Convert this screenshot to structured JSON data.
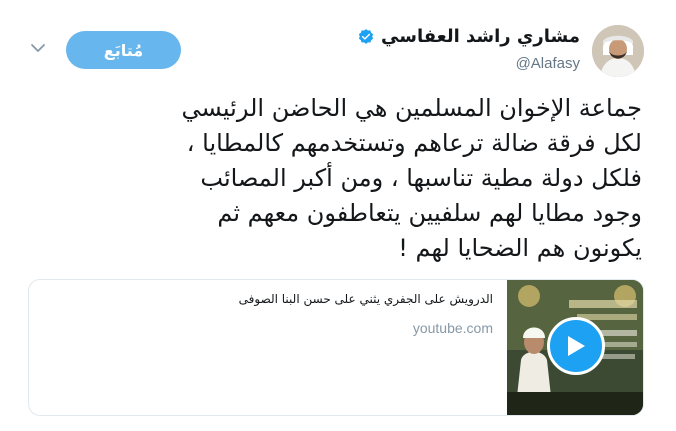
{
  "tweet": {
    "author": {
      "display_name": "مشاري راشد العفاسي",
      "handle": "@Alafasy",
      "verified": true
    },
    "follow_label": "مُتابَع",
    "text": "جماعة الإخوان المسلمين هي الحاضن الرئيسي\nلكل فرقة ضالة ترعاهم وتستخدمهم كالمطايا ،\nفلكل دولة مطية تناسبها ، ومن أكبر المصائب\nوجود مطايا لهم سلفيين يتعاطفون معهم ثم\nيكونون هم الضحايا لهم !",
    "card": {
      "title": "الدرويش على الجفري يثني على حسن البنا الصوفى",
      "domain": "youtube.com",
      "thumbnail_icon": "video-thumbnail",
      "play_icon": "play-icon"
    }
  },
  "colors": {
    "follow_button": "#67b7ee",
    "verified": "#1da1f2",
    "play_button": "#1da1f2",
    "muted_text": "#657786",
    "card_border": "#e1e8ed"
  }
}
